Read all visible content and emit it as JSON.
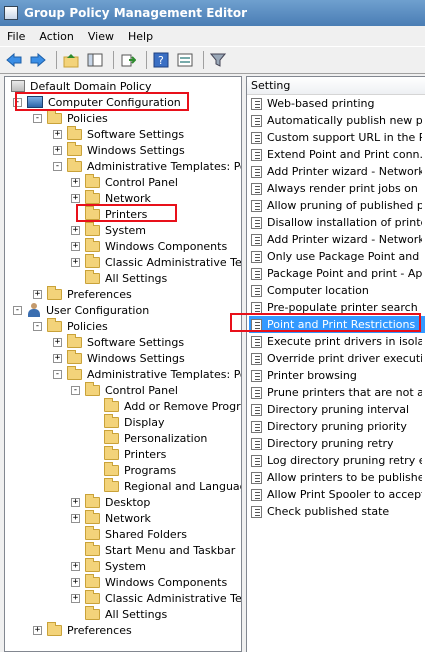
{
  "window": {
    "title": "Group Policy Management Editor"
  },
  "menu": {
    "file": "File",
    "action": "Action",
    "view": "View",
    "help": "Help"
  },
  "tree": [
    {
      "label": "Default Domain Policy",
      "level": 0
    },
    {
      "label": "Computer Configuration",
      "level": 0
    },
    {
      "label": "Policies",
      "level": 1
    },
    {
      "label": "Software Settings",
      "level": 2
    },
    {
      "label": "Windows Settings",
      "level": 2
    },
    {
      "label": "Administrative Templates: Policy",
      "level": 2
    },
    {
      "label": "Control Panel",
      "level": 3
    },
    {
      "label": "Network",
      "level": 3
    },
    {
      "label": "Printers",
      "level": 3
    },
    {
      "label": "System",
      "level": 3
    },
    {
      "label": "Windows Components",
      "level": 3
    },
    {
      "label": "Classic Administrative Templ",
      "level": 3
    },
    {
      "label": "All Settings",
      "level": 3
    },
    {
      "label": "Preferences",
      "level": 1
    },
    {
      "label": "User Configuration",
      "level": 0
    },
    {
      "label": "Policies",
      "level": 1
    },
    {
      "label": "Software Settings",
      "level": 2
    },
    {
      "label": "Windows Settings",
      "level": 2
    },
    {
      "label": "Administrative Templates: Policy",
      "level": 2
    },
    {
      "label": "Control Panel",
      "level": 3
    },
    {
      "label": "Add or Remove Program",
      "level": 4
    },
    {
      "label": "Display",
      "level": 4
    },
    {
      "label": "Personalization",
      "level": 4
    },
    {
      "label": "Printers",
      "level": 4
    },
    {
      "label": "Programs",
      "level": 4
    },
    {
      "label": "Regional and Language",
      "level": 4
    },
    {
      "label": "Desktop",
      "level": 3
    },
    {
      "label": "Network",
      "level": 3
    },
    {
      "label": "Shared Folders",
      "level": 3
    },
    {
      "label": "Start Menu and Taskbar",
      "level": 3
    },
    {
      "label": "System",
      "level": 3
    },
    {
      "label": "Windows Components",
      "level": 3
    },
    {
      "label": "Classic Administrative Templ",
      "level": 3
    },
    {
      "label": "All Settings",
      "level": 3
    },
    {
      "label": "Preferences",
      "level": 1
    }
  ],
  "settings": {
    "column_header": "Setting",
    "items": [
      "Web-based printing",
      "Automatically publish new pri...",
      "Custom support URL in the P...",
      "Extend Point and Print conn...",
      "Add Printer wizard - Network...",
      "Always render print jobs on ...",
      "Allow pruning of published pr...",
      "Disallow installation of printe...",
      "Add Printer wizard - Network...",
      "Only use Package Point and ...",
      "Package Point and print - Ap...",
      "Computer location",
      "Pre-populate printer search l...",
      "Point and Print Restrictions",
      "Execute print drivers in isola...",
      "Override print driver executi...",
      "Printer browsing",
      "Prune printers that are not a...",
      "Directory pruning interval",
      "Directory pruning priority",
      "Directory pruning retry",
      "Log directory pruning retry e...",
      "Allow printers to be published",
      "Allow Print Spooler to accept...",
      "Check published state"
    ]
  }
}
